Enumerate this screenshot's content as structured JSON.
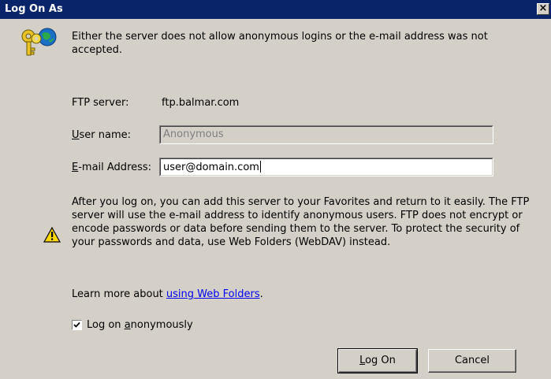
{
  "window": {
    "title": "Log On As",
    "close_label": "✕"
  },
  "message": "Either the server does not allow anonymous logins or the e-mail address was not accepted.",
  "ftp_server": {
    "label": "FTP server:",
    "value": "ftp.balmar.com"
  },
  "user_name": {
    "label_accel": "U",
    "label_rest": "ser name:",
    "value": "Anonymous"
  },
  "email": {
    "label_accel": "E",
    "label_rest": "-mail Address:",
    "value": "user@domain.com"
  },
  "info_text": "After you log on, you can add this server to your Favorites and return to it easily. The FTP server will use the e-mail address to identify anonymous users. FTP does not encrypt or encode passwords or data before sending them to the server.  To protect the security of your passwords and data, use Web Folders (WebDAV) instead.",
  "learn_more": {
    "prefix": "Learn more about ",
    "link_text": "using Web Folders",
    "suffix": "."
  },
  "anonymous_checkbox": {
    "checked": true,
    "label_before": "Log on ",
    "label_accel": "a",
    "label_after": "nonymously"
  },
  "buttons": {
    "logon_accel": "L",
    "logon_rest": "og On",
    "cancel": "Cancel"
  },
  "icons": {
    "keys": "keys-globe-icon",
    "warning": "warning-icon",
    "close": "close-icon",
    "check": "checkmark-icon"
  },
  "colors": {
    "titlebar": "#0a246a",
    "dialog_bg": "#d4d0c8",
    "link": "#0000ee",
    "warning_yellow": "#ffd800"
  }
}
